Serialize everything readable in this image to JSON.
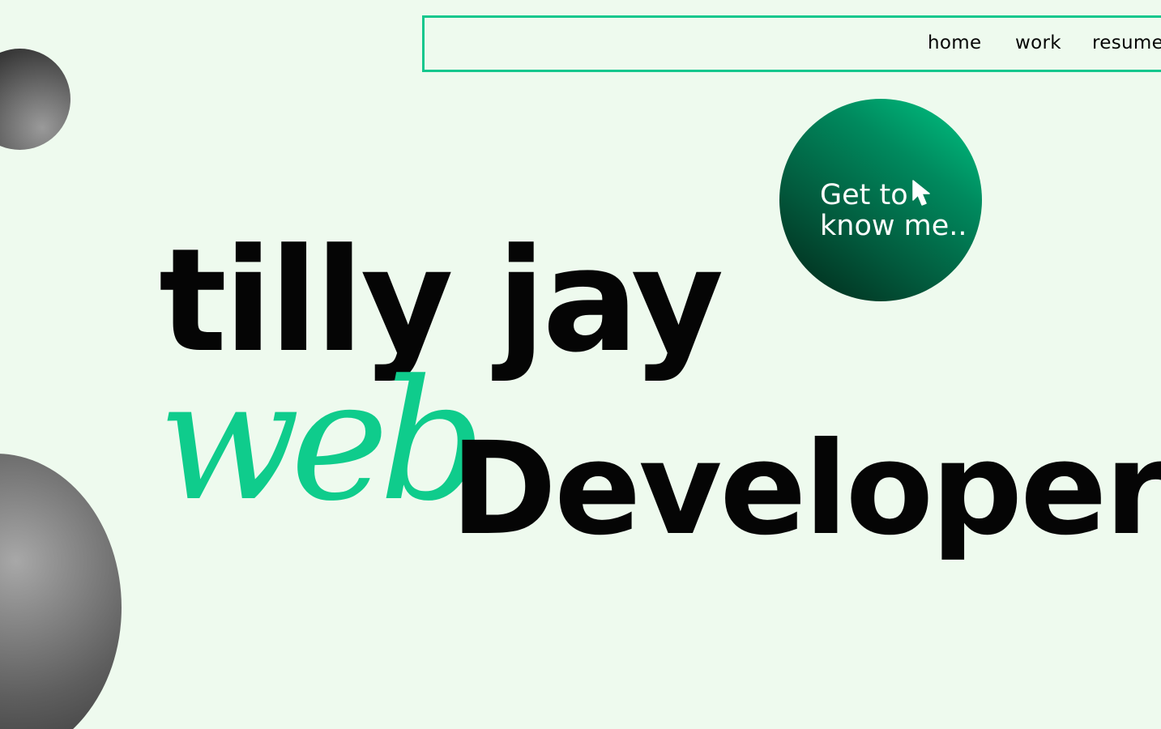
{
  "nav": {
    "links": [
      {
        "label": "home"
      },
      {
        "label": "work"
      },
      {
        "label": "resume"
      }
    ]
  },
  "cta": {
    "line1": "Get to",
    "line2": "know me..",
    "icon": "cursor-pointer-icon"
  },
  "hero": {
    "name": "tilly jay",
    "role_accent": "web",
    "role": "Developer"
  },
  "colors": {
    "background": "#eefaee",
    "accent": "#14c78d",
    "text": "#050505"
  }
}
